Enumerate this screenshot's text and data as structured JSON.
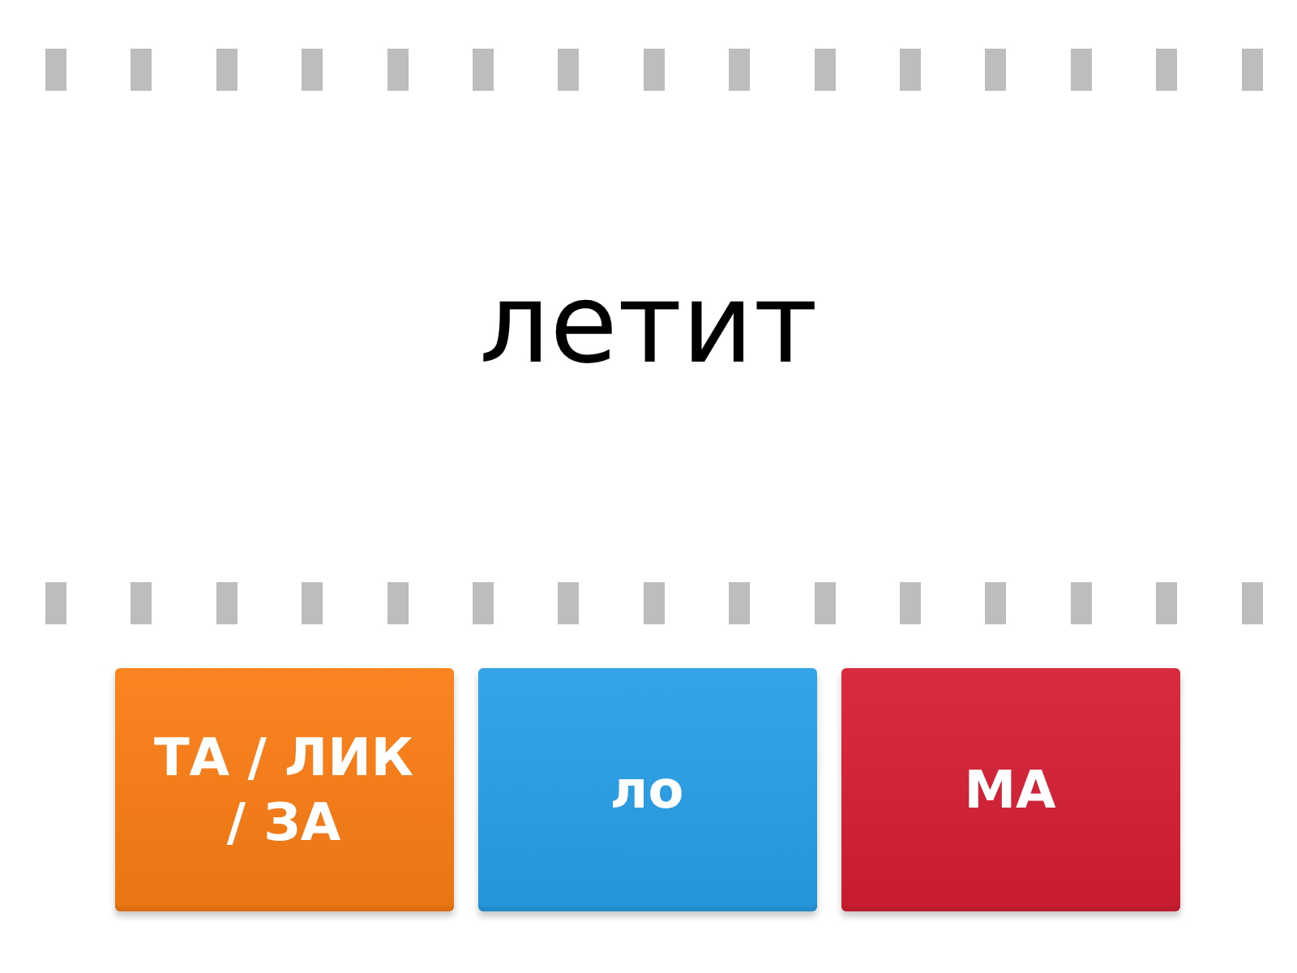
{
  "prompt": {
    "text": "летит"
  },
  "answers": [
    {
      "text": "ТА / ЛИК / ЗА",
      "color": "#fb7d14"
    },
    {
      "text": "ло",
      "color": "#289fe8"
    },
    {
      "text": "МА",
      "color": "#d61e33"
    }
  ]
}
